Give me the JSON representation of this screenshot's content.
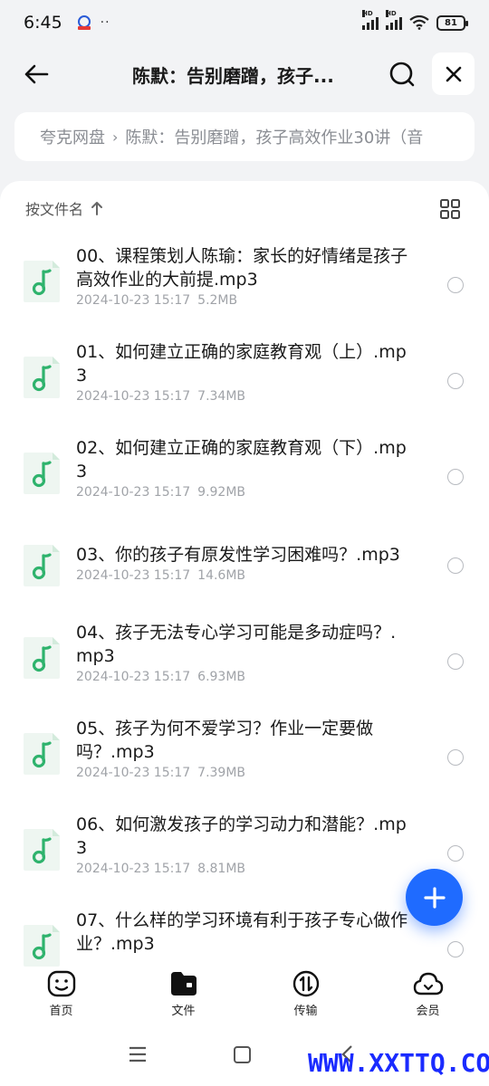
{
  "status_bar": {
    "time": "6:45",
    "dots": "··",
    "battery": "81",
    "hd": "HD"
  },
  "header": {
    "title": "陈默：告别磨蹭，孩子..."
  },
  "breadcrumb": {
    "root": "夸克网盘",
    "separator": "›",
    "current": "陈默：告别磨蹭，孩子高效作业30讲（音"
  },
  "sort": {
    "label": "按文件名"
  },
  "files": [
    {
      "name": "00、课程策划人陈瑜：家长的好情绪是孩子高效作业的大前提.mp3",
      "date": "2024-10-23 15:17",
      "size": "5.2MB"
    },
    {
      "name": "01、如何建立正确的家庭教育观（上）.mp3",
      "date": "2024-10-23 15:17",
      "size": "7.34MB"
    },
    {
      "name": "02、如何建立正确的家庭教育观（下）.mp3",
      "date": "2024-10-23 15:17",
      "size": "9.92MB"
    },
    {
      "name": "03、你的孩子有原发性学习困难吗？.mp3",
      "date": "2024-10-23 15:17",
      "size": "14.6MB"
    },
    {
      "name": "04、孩子无法专心学习可能是多动症吗？.mp3",
      "date": "2024-10-23 15:17",
      "size": "6.93MB"
    },
    {
      "name": "05、孩子为何不爱学习？作业一定要做吗？.mp3",
      "date": "2024-10-23 15:17",
      "size": "7.39MB"
    },
    {
      "name": "06、如何激发孩子的学习动力和潜能？.mp3",
      "date": "2024-10-23 15:17",
      "size": "8.81MB"
    },
    {
      "name": "07、什么样的学习环境有利于孩子专心做作业？.mp3",
      "date": "",
      "size": ""
    }
  ],
  "tabs": [
    {
      "label": "首页"
    },
    {
      "label": "文件"
    },
    {
      "label": "传输"
    },
    {
      "label": "会员"
    }
  ],
  "watermark": "WWW.XXTTQ.COM",
  "colors": {
    "accent": "#1f6bff",
    "audio_icon": "#2fb36d",
    "background": "#f2f3f5"
  }
}
